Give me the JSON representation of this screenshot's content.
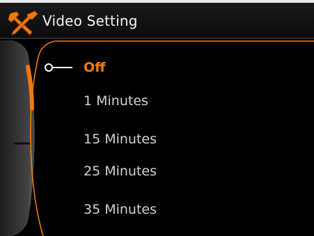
{
  "header": {
    "title": "Video Setting",
    "icon": "tools-icon"
  },
  "menu": {
    "selected_index": 0,
    "items": [
      {
        "label": "Off",
        "selected": true
      },
      {
        "label": "1 Minutes",
        "selected": false
      },
      {
        "label": "15 Minutes",
        "selected": false
      },
      {
        "label": "25 Minutes",
        "selected": false
      },
      {
        "label": "35 Minutes",
        "selected": false
      }
    ]
  },
  "colors": {
    "accent": "#ef7a10",
    "text": "#d2d2d2",
    "background": "#000000",
    "header_text": "#f2f2f2"
  }
}
